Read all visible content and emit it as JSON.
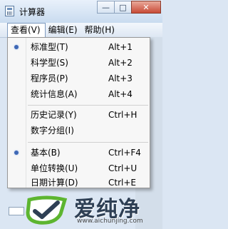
{
  "window": {
    "title": "计算器",
    "controls": [
      "—",
      "□",
      "✕"
    ]
  },
  "menubar": {
    "items": [
      {
        "label": "查看(V)"
      },
      {
        "label": "编辑(E)"
      },
      {
        "label": "帮助(H)"
      }
    ]
  },
  "view_menu": {
    "items": [
      {
        "label": "标准型(T)",
        "shortcut": "Alt+1",
        "checked": true
      },
      {
        "label": "科学型(S)",
        "shortcut": "Alt+2",
        "checked": false
      },
      {
        "label": "程序员(P)",
        "shortcut": "Alt+3",
        "checked": false
      },
      {
        "label": "统计信息(A)",
        "shortcut": "Alt+4",
        "checked": false
      },
      {
        "label": "历史记录(Y)",
        "shortcut": "Ctrl+H",
        "checked": false
      },
      {
        "label": "数字分组(I)",
        "shortcut": "",
        "checked": false
      },
      {
        "label": "基本(B)",
        "shortcut": "Ctrl+F4",
        "checked": true
      },
      {
        "label": "单位转换(U)",
        "shortcut": "Ctrl+U",
        "checked": false
      },
      {
        "label": "日期计算(D)",
        "shortcut": "Ctrl+E",
        "checked": false
      }
    ]
  },
  "watermark": {
    "text": "爱纯净",
    "url": "www.aichunjing.com"
  },
  "colors": {
    "bullet": "#3f68b5",
    "logo_green": "#5db530",
    "title_bar": "#c9dbef"
  }
}
